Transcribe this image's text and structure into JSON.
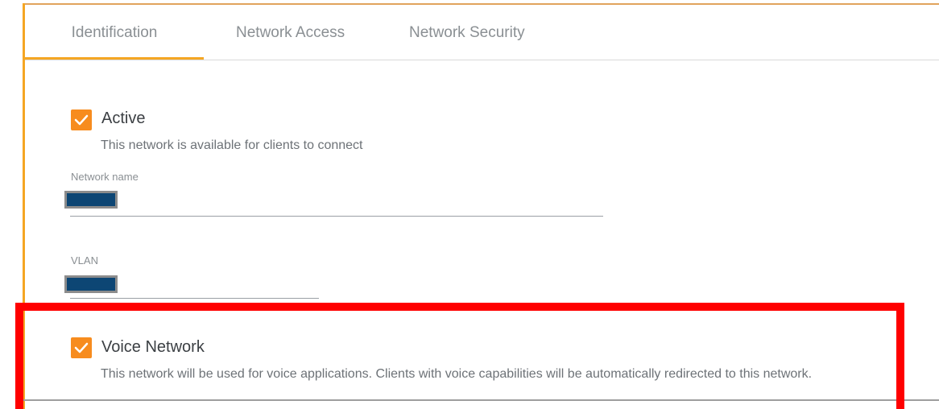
{
  "tabs": [
    {
      "label": "Identification",
      "active": true
    },
    {
      "label": "Network Access",
      "active": false
    },
    {
      "label": "Network Security",
      "active": false
    }
  ],
  "active": {
    "label": "Active",
    "checked": true,
    "description": "This network is available for clients to connect"
  },
  "network_name": {
    "label": "Network name",
    "value_redacted": true
  },
  "vlan": {
    "label": "VLAN",
    "value_redacted": true
  },
  "voice_network": {
    "label": "Voice Network",
    "checked": true,
    "description": "This network will be used for voice applications. Clients with voice capabilities will be automatically redirected to this network."
  },
  "colors": {
    "accent": "#f5a623",
    "checkbox": "#f78c1e",
    "redaction": "#0d4674",
    "highlight": "#ff0000"
  },
  "icons": {
    "checkbox_check": "check-icon"
  }
}
